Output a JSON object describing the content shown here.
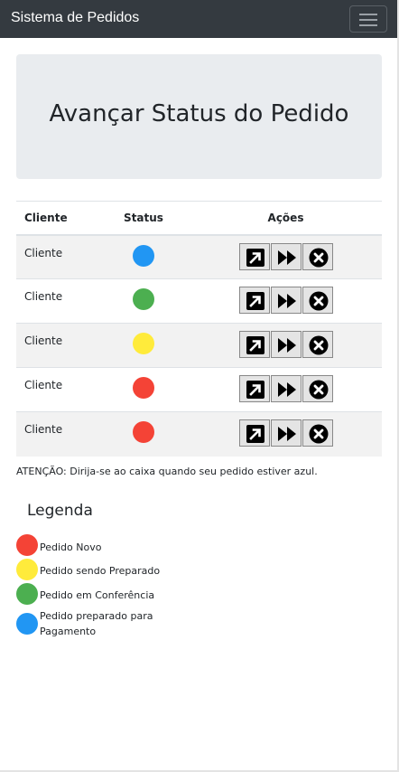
{
  "navbar": {
    "brand": "Sistema de Pedidos"
  },
  "jumbotron": {
    "title": "Avançar Status do Pedido"
  },
  "table": {
    "headers": {
      "cliente": "Cliente",
      "status": "Status",
      "acoes": "Ações"
    },
    "rows": [
      {
        "cliente": "Cliente",
        "status_color": "#2196f3"
      },
      {
        "cliente": "Cliente",
        "status_color": "#4caf50"
      },
      {
        "cliente": "Cliente",
        "status_color": "#ffeb3b"
      },
      {
        "cliente": "Cliente",
        "status_color": "#f44336"
      },
      {
        "cliente": "Cliente",
        "status_color": "#f44336"
      }
    ],
    "action_icons": [
      "open-external-icon",
      "fast-forward-icon",
      "cancel-icon"
    ]
  },
  "atencao": "ATENÇÃO: Dirija-se ao caixa quando seu pedido estiver azul.",
  "legenda": {
    "title": "Legenda",
    "items": [
      {
        "label": "Pedido Novo",
        "color": "#f44336"
      },
      {
        "label": "Pedido sendo Preparado",
        "color": "#ffeb3b"
      },
      {
        "label": "Pedido em Conferência",
        "color": "#4caf50"
      },
      {
        "label": "Pedido preparado para Pagamento",
        "color": "#2196f3"
      }
    ]
  }
}
